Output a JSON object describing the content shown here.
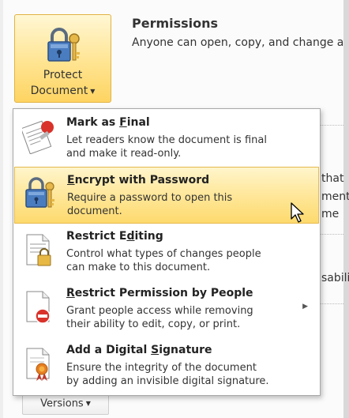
{
  "header": {
    "protect_button": {
      "line1": "Protect",
      "line2": "Document",
      "icon": "lock-key-icon"
    },
    "permissions_title": "Permissions",
    "permissions_desc": "Anyone can open, copy, and change a"
  },
  "background_fragments": {
    "frag1": "that",
    "frag2": "ment",
    "frag3": "me",
    "frag4": "sabili"
  },
  "versions_button": {
    "label": "Versions",
    "icon": "caret-down-icon"
  },
  "menu": {
    "items": [
      {
        "title_pre": "Mark as ",
        "title_key": "F",
        "title_post": "inal",
        "desc1": "Let readers know the document is final",
        "desc2": "and make it read-only.",
        "icon": "mark-final-icon",
        "highlighted": false,
        "has_submenu": false
      },
      {
        "title_pre": "",
        "title_key": "E",
        "title_post": "ncrypt with Password",
        "desc1": "Require a password to open this",
        "desc2": "document.",
        "icon": "lock-key-icon",
        "highlighted": true,
        "has_submenu": false
      },
      {
        "title_pre": "Restrict E",
        "title_key": "d",
        "title_post": "iting",
        "desc1": "Control what types of changes people",
        "desc2": "can make to this document.",
        "icon": "restrict-editing-icon",
        "highlighted": false,
        "has_submenu": false
      },
      {
        "title_pre": "",
        "title_key": "R",
        "title_post": "estrict Permission by People",
        "desc1": "Grant people access while removing",
        "desc2": "their ability to edit, copy, or print.",
        "icon": "restrict-permission-icon",
        "highlighted": false,
        "has_submenu": true
      },
      {
        "title_pre": "Add a Digital ",
        "title_key": "S",
        "title_post": "ignature",
        "desc1": "Ensure the integrity of the document",
        "desc2": "by adding an invisible digital signature.",
        "icon": "digital-signature-icon",
        "highlighted": false,
        "has_submenu": false
      }
    ]
  },
  "colors": {
    "highlight": "#ffe79a",
    "highlight_border": "#e5b94d",
    "accent_red": "#d9322b"
  }
}
